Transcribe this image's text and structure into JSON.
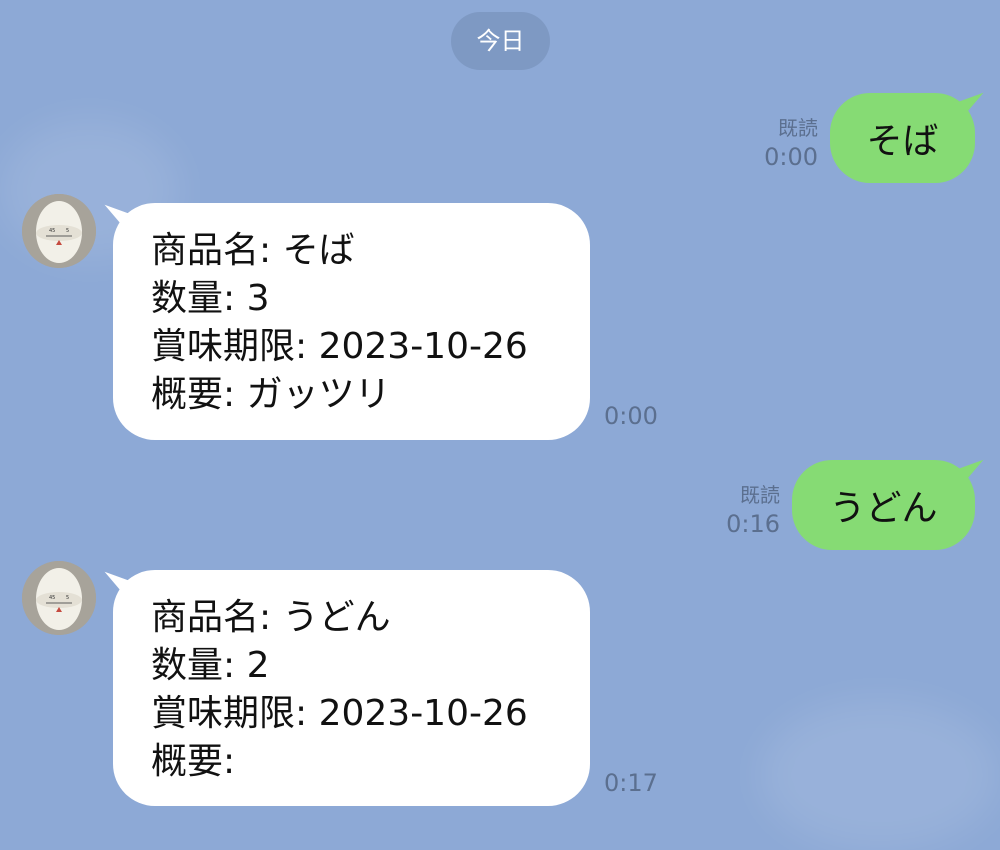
{
  "chat": {
    "date_label": "今日",
    "messages": [
      {
        "side": "outgoing",
        "text": "そば",
        "read_label": "既読",
        "time": "0:00"
      },
      {
        "side": "incoming",
        "lines": [
          "商品名: そば",
          "数量: 3",
          "賞味期限: 2023-10-26",
          "概要: ガッツリ"
        ],
        "time": "0:00"
      },
      {
        "side": "outgoing",
        "text": "うどん",
        "read_label": "既読",
        "time": "0:16"
      },
      {
        "side": "incoming",
        "lines": [
          "商品名: うどん",
          "数量: 2",
          "賞味期限: 2023-10-26",
          "概要:"
        ],
        "time": "0:17"
      }
    ]
  },
  "icons": {
    "avatar_icon": "egg-timer-avatar-icon"
  },
  "colors": {
    "background": "#8da9d6",
    "outgoing_bubble": "#86db74",
    "incoming_bubble": "#ffffff",
    "meta_text": "#5b6f8f",
    "date_chip": "#738cb4"
  }
}
